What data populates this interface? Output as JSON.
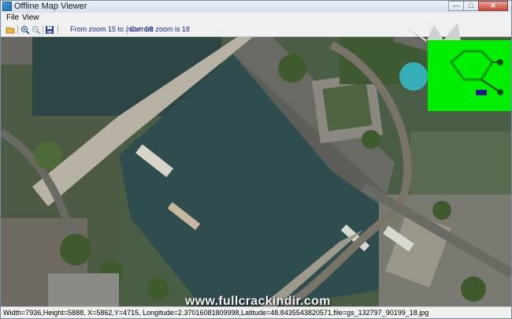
{
  "window": {
    "title": "Offline Map Viewer",
    "controls": {
      "minimize": "—",
      "maximize": "□",
      "close": "✕"
    }
  },
  "menu": {
    "file": "File",
    "view": "View"
  },
  "toolbar": {
    "zoom_range": "From zoom 15 to zoom 18",
    "current_zoom": "Current zoom is 18"
  },
  "status": {
    "text": "Width=7936,Height=5888, X=5862,Y=4715, Longitude=2.37016081809998,Latitude=48.8435543820571,file=gs_132797_90199_18.jpg"
  },
  "watermark": "www.fullcrackindir.com",
  "colors": {
    "river": "#2f4d4f",
    "bridge": "#b8b2a4",
    "road": "#6a6a64",
    "foliage": "#3f5a2c",
    "logo_green": "#00ee00"
  }
}
